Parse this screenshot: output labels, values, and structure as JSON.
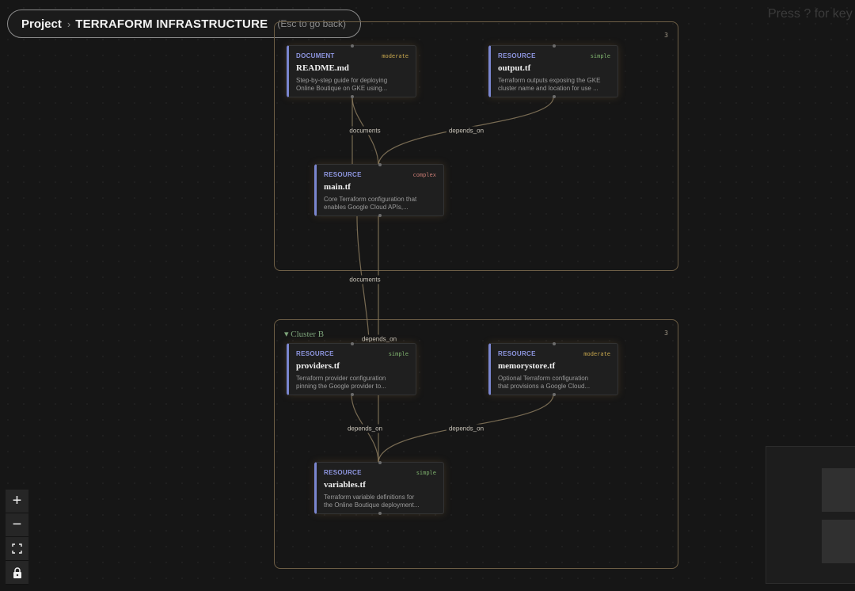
{
  "breadcrumb": {
    "project": "Project",
    "separator": "›",
    "current": "TERRAFORM INFRASTRUCTURE",
    "hint": "(Esc to go back)"
  },
  "key_hint": "Press ? for key",
  "clusters": [
    {
      "label": "",
      "count": "3"
    },
    {
      "label": "Cluster B",
      "count": "3"
    }
  ],
  "nodes": {
    "readme": {
      "type": "DOCUMENT",
      "complexity": "moderate",
      "title": "README.md",
      "desc1": "Step-by-step guide for deploying",
      "desc2": "Online Boutique on GKE using..."
    },
    "output": {
      "type": "RESOURCE",
      "complexity": "simple",
      "title": "output.tf",
      "desc1": "Terraform outputs exposing the GKE",
      "desc2": "cluster name and location for use ..."
    },
    "main": {
      "type": "RESOURCE",
      "complexity": "complex",
      "title": "main.tf",
      "desc1": "Core Terraform configuration that",
      "desc2": "enables Google Cloud APIs,..."
    },
    "providers": {
      "type": "RESOURCE",
      "complexity": "simple",
      "title": "providers.tf",
      "desc1": "Terraform provider configuration",
      "desc2": "pinning the Google provider to..."
    },
    "memorystore": {
      "type": "RESOURCE",
      "complexity": "moderate",
      "title": "memorystore.tf",
      "desc1": "Optional Terraform configuration",
      "desc2": "that provisions a Google Cloud..."
    },
    "variables": {
      "type": "RESOURCE",
      "complexity": "simple",
      "title": "variables.tf",
      "desc1": "Terraform variable definitions for",
      "desc2": "the Online Boutique deployment..."
    }
  },
  "edge_labels": {
    "documents_top": "documents",
    "depends_on_top": "depends_on",
    "documents_mid": "documents",
    "depends_on_mid": "depends_on",
    "depends_on_b_left": "depends_on",
    "depends_on_b_right": "depends_on"
  },
  "controls": {
    "zoom_in": "+",
    "zoom_out": "−",
    "fit_view": "⛶",
    "lock": "🔒"
  },
  "colors": {
    "background": "#161616",
    "cluster_border": "#6e5f46",
    "edge": "#8a7a5e",
    "type_label": "#8e96e0",
    "moderate": "#c9a84e",
    "simple": "#7fb36e",
    "complex": "#c97b73"
  }
}
